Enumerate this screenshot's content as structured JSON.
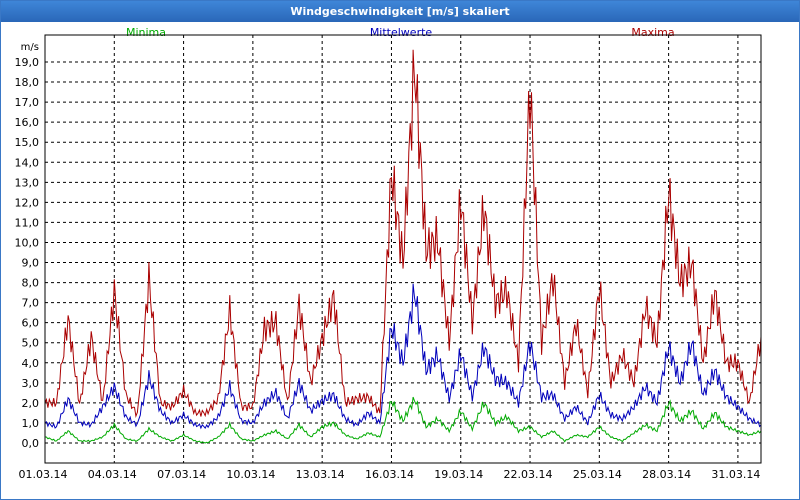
{
  "window": {
    "title": "Windgeschwindigkeit [m/s] skaliert"
  },
  "chart_data": {
    "type": "line",
    "title": "Windgeschwindigkeit [m/s] skaliert",
    "ylabel": "m/s",
    "xlabel": "",
    "ylim": [
      0,
      19.5
    ],
    "xlim": [
      0,
      31
    ],
    "grid": true,
    "y_ticks": [
      "0,0",
      "1,0",
      "2,0",
      "3,0",
      "4,0",
      "5,0",
      "6,0",
      "7,0",
      "8,0",
      "9,0",
      "10,0",
      "11,0",
      "12,0",
      "13,0",
      "14,0",
      "15,0",
      "16,0",
      "17,0",
      "18,0",
      "19,0"
    ],
    "x_tick_labels": [
      "01.03.14",
      "04.03.14",
      "07.03.14",
      "10.03.14",
      "13.03.14",
      "16.03.14",
      "19.03.14",
      "22.03.14",
      "25.03.14",
      "28.03.14",
      "31.03.14"
    ],
    "x_tick_days": [
      0,
      3,
      6,
      9,
      12,
      15,
      18,
      21,
      24,
      27,
      30
    ],
    "legend_placement": "top",
    "series": [
      {
        "name": "Minima",
        "color": "#00aa00",
        "x": [
          0,
          0.5,
          1,
          1.5,
          2,
          2.5,
          3,
          3.5,
          4,
          4.5,
          5,
          5.5,
          6,
          6.5,
          7,
          7.5,
          8,
          8.5,
          9,
          9.5,
          10,
          10.5,
          11,
          11.5,
          12,
          12.5,
          13,
          13.5,
          14,
          14.5,
          15,
          15.5,
          16,
          16.5,
          17,
          17.5,
          18,
          18.5,
          19,
          19.5,
          20,
          20.5,
          21,
          21.5,
          22,
          22.5,
          23,
          23.5,
          24,
          24.5,
          25,
          25.5,
          26,
          26.5,
          27,
          27.5,
          28,
          28.5,
          29,
          29.5,
          30,
          30.5,
          31
        ],
        "values": [
          0.3,
          0.1,
          0.6,
          0.1,
          0.1,
          0.3,
          0.9,
          0.2,
          0.1,
          0.7,
          0.3,
          0.1,
          0.4,
          0.1,
          0.0,
          0.3,
          0.9,
          0.2,
          0.1,
          0.4,
          0.6,
          0.2,
          0.9,
          0.3,
          0.8,
          1.0,
          0.4,
          0.2,
          0.5,
          0.3,
          2.1,
          1.1,
          2.2,
          0.8,
          1.2,
          0.6,
          1.6,
          0.7,
          2.0,
          1.0,
          1.3,
          0.6,
          0.8,
          0.3,
          0.6,
          0.1,
          0.4,
          0.3,
          0.8,
          0.3,
          0.1,
          0.5,
          0.9,
          0.6,
          2.0,
          1.1,
          1.6,
          0.7,
          1.5,
          0.8,
          0.6,
          0.4,
          0.6
        ]
      },
      {
        "name": "Mittelwerte",
        "color": "#0000bb",
        "x": [
          0,
          0.5,
          1,
          1.5,
          2,
          2.5,
          3,
          3.5,
          4,
          4.5,
          5,
          5.5,
          6,
          6.5,
          7,
          7.5,
          8,
          8.5,
          9,
          9.5,
          10,
          10.5,
          11,
          11.5,
          12,
          12.5,
          13,
          13.5,
          14,
          14.5,
          15,
          15.5,
          16,
          16.5,
          17,
          17.5,
          18,
          18.5,
          19,
          19.5,
          20,
          20.5,
          21,
          21.5,
          22,
          22.5,
          23,
          23.5,
          24,
          24.5,
          25,
          25.5,
          26,
          26.5,
          27,
          27.5,
          28,
          28.5,
          29,
          29.5,
          30,
          30.5,
          31
        ],
        "values": [
          1.0,
          0.8,
          2.2,
          1.0,
          0.9,
          1.8,
          2.8,
          1.3,
          0.9,
          3.3,
          1.6,
          1.0,
          1.4,
          0.9,
          0.8,
          1.3,
          2.8,
          1.1,
          1.0,
          2.0,
          2.5,
          1.2,
          3.0,
          1.6,
          2.1,
          2.4,
          1.2,
          0.9,
          1.5,
          1.0,
          5.8,
          4.0,
          7.6,
          3.6,
          4.4,
          2.2,
          4.5,
          2.3,
          4.8,
          3.2,
          3.0,
          2.0,
          5.0,
          2.3,
          2.4,
          1.2,
          1.8,
          1.0,
          2.4,
          1.4,
          1.2,
          1.8,
          2.8,
          2.0,
          4.8,
          3.0,
          5.0,
          2.4,
          3.6,
          2.3,
          1.8,
          1.2,
          0.9
        ]
      },
      {
        "name": "Maxima",
        "color": "#aa0000",
        "x": [
          0,
          0.5,
          1,
          1.5,
          2,
          2.5,
          3,
          3.5,
          4,
          4.5,
          5,
          5.5,
          6,
          6.5,
          7,
          7.5,
          8,
          8.5,
          9,
          9.5,
          10,
          10.5,
          11,
          11.5,
          12,
          12.5,
          13,
          13.5,
          14,
          14.5,
          15,
          15.5,
          16,
          16.5,
          17,
          17.5,
          18,
          18.5,
          19,
          19.5,
          20,
          20.5,
          21,
          21.5,
          22,
          22.5,
          23,
          23.5,
          24,
          24.5,
          25,
          25.5,
          26,
          26.5,
          27,
          27.5,
          28,
          28.5,
          29,
          29.5,
          30,
          30.5,
          31
        ],
        "values": [
          2.0,
          2.0,
          6.2,
          1.9,
          5.3,
          2.0,
          7.6,
          2.4,
          1.4,
          8.2,
          2.0,
          1.8,
          2.6,
          1.5,
          1.5,
          2.2,
          6.6,
          1.8,
          1.8,
          5.7,
          6.0,
          2.0,
          6.9,
          3.0,
          5.2,
          7.3,
          2.0,
          2.2,
          2.3,
          1.5,
          13.5,
          9.0,
          18.9,
          9.6,
          10.2,
          5.0,
          12.2,
          6.0,
          11.8,
          7.0,
          7.6,
          4.0,
          17.8,
          5.0,
          8.3,
          3.0,
          6.0,
          2.5,
          7.8,
          3.0,
          4.4,
          3.0,
          6.8,
          5.0,
          12.5,
          8.0,
          9.0,
          4.0,
          7.5,
          4.0,
          4.0,
          2.0,
          5.3
        ]
      }
    ]
  }
}
